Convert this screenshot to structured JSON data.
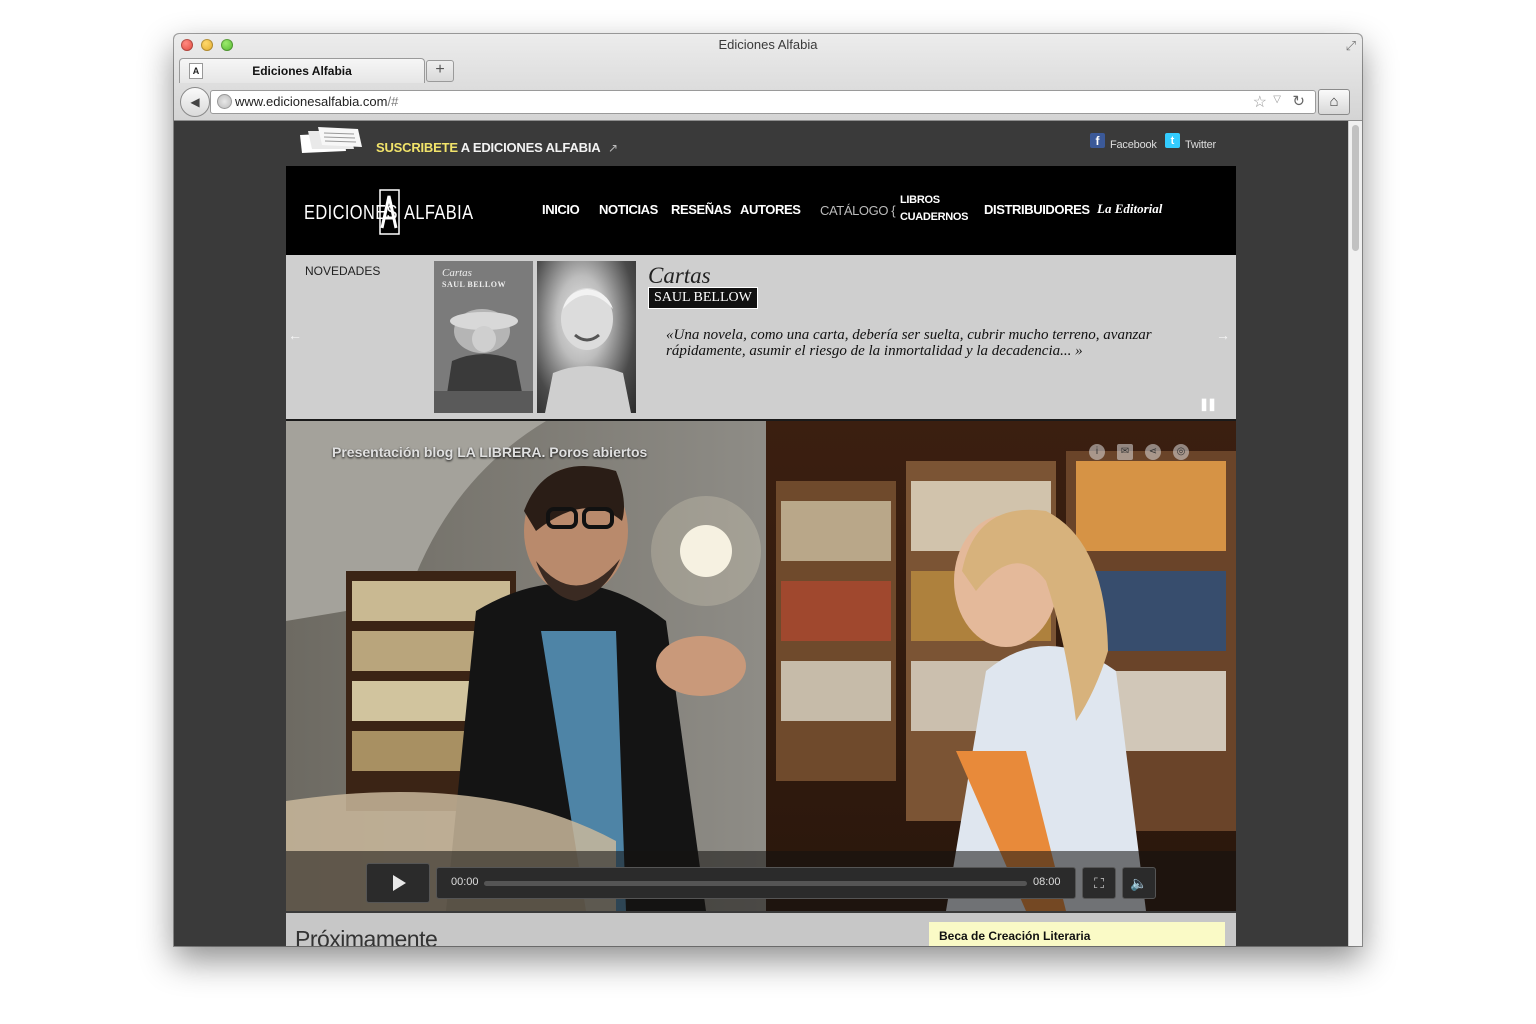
{
  "browser": {
    "window_title": "Ediciones Alfabia",
    "tab_label": "Ediciones Alfabia",
    "new_tab_symbol": "+",
    "url_host": "www.edicionesalfabia.com",
    "url_path": "/#"
  },
  "header": {
    "subscribe_highlight": "SUSCRIBETE",
    "subscribe_rest": " A EDICIONES ALFABIA",
    "facebook_label": "Facebook",
    "twitter_label": "Twitter"
  },
  "logo": {
    "word_left": "EDICIONES",
    "letter": "A",
    "word_right": "ALFABIA"
  },
  "nav": {
    "inicio": "INICIO",
    "noticias": "NOTICIAS",
    "resenas": "RESEÑAS",
    "autores": "AUTORES",
    "catalogo": "CATÁLOGO {",
    "libros": "LIBROS",
    "cuadernos": "CUADERNOS",
    "distribuidores": "DISTRIBUIDORES",
    "editorial": "La Editorial"
  },
  "slider": {
    "section_label": "NOVEDADES",
    "cover_title": "Cartas",
    "cover_author": "SAUL BELLOW",
    "book_title": "Cartas",
    "book_author": "SAUL BELLOW",
    "quote": "«Una novela, como una carta, debería ser suelta, cubrir mucho terreno, avanzar rápidamente, asumir el riesgo de la inmortalidad y la decadencia... »"
  },
  "video": {
    "title": "Presentación blog LA LIBRERA. Poros abiertos",
    "current_time": "00:00",
    "duration": "08:00",
    "progress": 0
  },
  "bottom": {
    "section_title": "Próximamente",
    "beca_label": "Beca de Creación Literaria"
  },
  "colors": {
    "subscribe_highlight": "#f1e36a",
    "beca_background": "#fafac6",
    "facebook": "#3b5998",
    "twitter": "#33ccff"
  }
}
